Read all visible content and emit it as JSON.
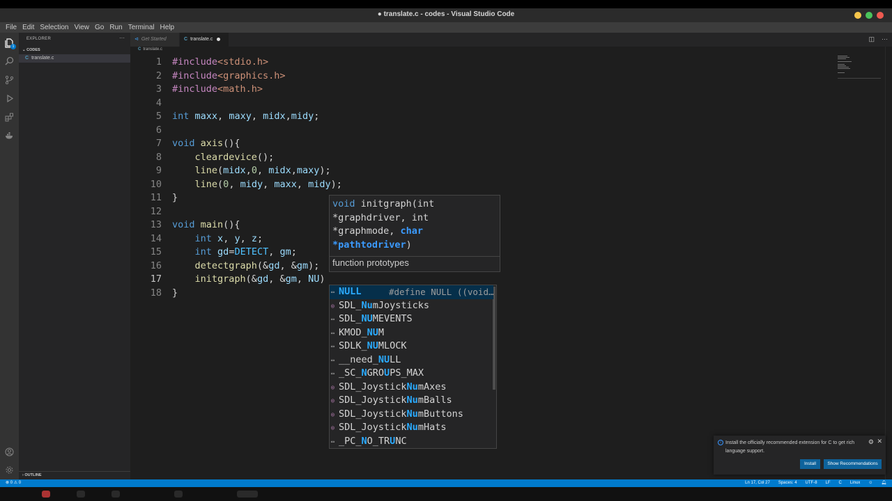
{
  "window": {
    "title": "● translate.c - codes - Visual Studio Code"
  },
  "menu": [
    "File",
    "Edit",
    "Selection",
    "View",
    "Go",
    "Run",
    "Terminal",
    "Help"
  ],
  "activity": {
    "badge": "1"
  },
  "sidebar": {
    "header": "EXPLORER",
    "dots": "···",
    "folder": "CODES",
    "file_icon": "C",
    "file": "translate.c",
    "outline": "OUTLINE"
  },
  "tabs": {
    "get_started": "Get Started",
    "vs_icon": "⊲",
    "active_icon": "C",
    "active": "translate.c"
  },
  "breadcrumb": {
    "icon": "C",
    "file": "translate.c"
  },
  "code": {
    "line_numbers": [
      "1",
      "2",
      "3",
      "4",
      "5",
      "6",
      "7",
      "8",
      "9",
      "10",
      "11",
      "12",
      "13",
      "14",
      "15",
      "16",
      "17",
      "18"
    ],
    "current_line": 17,
    "lines": [
      [
        [
          "inc",
          "#include"
        ],
        [
          "str",
          "<stdio.h>"
        ]
      ],
      [
        [
          "inc",
          "#include"
        ],
        [
          "str",
          "<graphics.h>"
        ]
      ],
      [
        [
          "inc",
          "#include"
        ],
        [
          "str",
          "<math.h>"
        ]
      ],
      [],
      [
        [
          "kw",
          "int"
        ],
        [
          "pun",
          " "
        ],
        [
          "var",
          "maxx"
        ],
        [
          "pun",
          ", "
        ],
        [
          "var",
          "maxy"
        ],
        [
          "pun",
          ", "
        ],
        [
          "var",
          "midx"
        ],
        [
          "pun",
          ","
        ],
        [
          "var",
          "midy"
        ],
        [
          "pun",
          ";"
        ]
      ],
      [],
      [
        [
          "kw",
          "void"
        ],
        [
          "pun",
          " "
        ],
        [
          "fn",
          "axis"
        ],
        [
          "pun",
          "(){"
        ]
      ],
      [
        [
          "pun",
          "    "
        ],
        [
          "fn",
          "cleardevice"
        ],
        [
          "pun",
          "();"
        ]
      ],
      [
        [
          "pun",
          "    "
        ],
        [
          "fn",
          "line"
        ],
        [
          "pun",
          "("
        ],
        [
          "var",
          "midx"
        ],
        [
          "pun",
          ","
        ],
        [
          "num",
          "0"
        ],
        [
          "pun",
          ", "
        ],
        [
          "var",
          "midx"
        ],
        [
          "pun",
          ","
        ],
        [
          "var",
          "maxy"
        ],
        [
          "pun",
          ");"
        ]
      ],
      [
        [
          "pun",
          "    "
        ],
        [
          "fn",
          "line"
        ],
        [
          "pun",
          "("
        ],
        [
          "num",
          "0"
        ],
        [
          "pun",
          ", "
        ],
        [
          "var",
          "midy"
        ],
        [
          "pun",
          ", "
        ],
        [
          "var",
          "maxx"
        ],
        [
          "pun",
          ", "
        ],
        [
          "var",
          "midy"
        ],
        [
          "pun",
          ");"
        ]
      ],
      [
        [
          "pun",
          "}"
        ]
      ],
      [],
      [
        [
          "kw",
          "void"
        ],
        [
          "pun",
          " "
        ],
        [
          "fn",
          "main"
        ],
        [
          "pun",
          "(){"
        ]
      ],
      [
        [
          "pun",
          "    "
        ],
        [
          "kw",
          "int"
        ],
        [
          "pun",
          " "
        ],
        [
          "var",
          "x"
        ],
        [
          "pun",
          ", "
        ],
        [
          "var",
          "y"
        ],
        [
          "pun",
          ", "
        ],
        [
          "var",
          "z"
        ],
        [
          "pun",
          ";"
        ]
      ],
      [
        [
          "pun",
          "    "
        ],
        [
          "kw",
          "int"
        ],
        [
          "pun",
          " "
        ],
        [
          "var",
          "gd"
        ],
        [
          "pun",
          "="
        ],
        [
          "cst",
          "DETECT"
        ],
        [
          "pun",
          ", "
        ],
        [
          "var",
          "gm"
        ],
        [
          "pun",
          ";"
        ]
      ],
      [
        [
          "pun",
          "    "
        ],
        [
          "fn",
          "detectgraph"
        ],
        [
          "pun",
          "(&"
        ],
        [
          "var",
          "gd"
        ],
        [
          "pun",
          ", &"
        ],
        [
          "var",
          "gm"
        ],
        [
          "pun",
          ");"
        ]
      ],
      [
        [
          "pun",
          "    "
        ],
        [
          "fn",
          "initgraph"
        ],
        [
          "pun",
          "(&"
        ],
        [
          "var",
          "gd"
        ],
        [
          "pun",
          ", &"
        ],
        [
          "var",
          "gm"
        ],
        [
          "pun",
          ", "
        ],
        [
          "var",
          "NU"
        ],
        [
          "pun",
          ")"
        ]
      ],
      [
        [
          "pun",
          "}"
        ]
      ]
    ]
  },
  "hover": {
    "l1_void": "void",
    "l1_rest": " initgraph(int",
    "l2": "*graphdriver, int",
    "l3_a": "*graphmode, ",
    "l3_b": "char",
    "l4_a": "*pathtodriver",
    "l4_b": ")",
    "doc": "function prototypes"
  },
  "suggestions": [
    {
      "icon": "macro",
      "pre": "",
      "match": "NULL",
      "post": "",
      "detail": "#define NULL ((void…",
      "selected": true
    },
    {
      "icon": "cube",
      "pre": "SDL_",
      "match": "Nu",
      "post": "mJoysticks",
      "detail": ""
    },
    {
      "icon": "macro",
      "pre": "SDL_",
      "match": "NU",
      "post": "MEVENTS",
      "detail": ""
    },
    {
      "icon": "macro",
      "pre": "KMOD_",
      "match": "NU",
      "post": "M",
      "detail": ""
    },
    {
      "icon": "macro",
      "pre": "SDLK_",
      "match": "NU",
      "post": "MLOCK",
      "detail": ""
    },
    {
      "icon": "macro",
      "pre": "__need_",
      "match": "NU",
      "post": "LL",
      "detail": ""
    },
    {
      "icon": "macro",
      "pre": "_SC_",
      "match": "N",
      "post": "GRO",
      "match2": "U",
      "post2": "PS_MAX",
      "detail": ""
    },
    {
      "icon": "cube",
      "pre": "SDL_Joystick",
      "match": "Nu",
      "post": "mAxes",
      "detail": ""
    },
    {
      "icon": "cube",
      "pre": "SDL_Joystick",
      "match": "Nu",
      "post": "mBalls",
      "detail": ""
    },
    {
      "icon": "cube",
      "pre": "SDL_Joystick",
      "match": "Nu",
      "post": "mButtons",
      "detail": ""
    },
    {
      "icon": "cube",
      "pre": "SDL_Joystick",
      "match": "Nu",
      "post": "mHats",
      "detail": ""
    },
    {
      "icon": "macro",
      "pre": "_PC_",
      "match": "N",
      "post": "O_TR",
      "match2": "U",
      "post2": "NC",
      "detail": ""
    }
  ],
  "notification": {
    "message": "Install the officially recommended extension for C to get rich language support.",
    "install": "Install",
    "recommendations": "Show Recommendations"
  },
  "status": {
    "problems": "⊗ 0 ⚠ 0",
    "position": "Ln 17, Col 27",
    "spaces": "Spaces: 4",
    "encoding": "UTF-8",
    "eol": "LF",
    "language": "C",
    "platform": "Linux"
  },
  "colors": {
    "accent": "#007acc",
    "editor_bg": "#1e1e1e",
    "sidebar_bg": "#252526"
  }
}
